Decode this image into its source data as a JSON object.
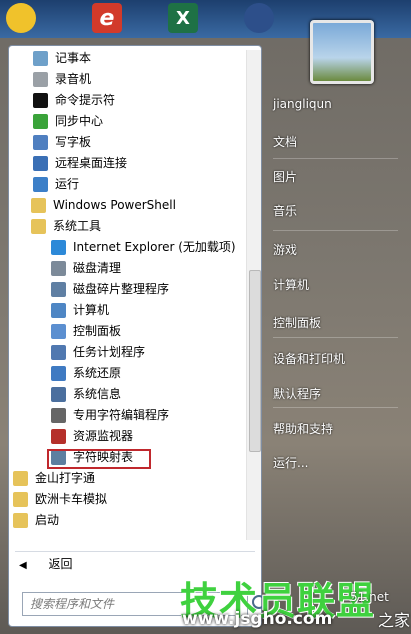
{
  "taskbar_icons": [
    "qq-icon",
    "browser-e-icon",
    "excel-icon",
    "app-icon"
  ],
  "excel_glyph": "X",
  "browser_glyph": "e",
  "programs": [
    {
      "label": "记事本",
      "icon": "notepad-icon",
      "color": "#6ea0c9"
    },
    {
      "label": "录音机",
      "icon": "microphone-icon",
      "color": "#9aa0a6"
    },
    {
      "label": "命令提示符",
      "icon": "cmd-icon",
      "color": "#111111"
    },
    {
      "label": "同步中心",
      "icon": "sync-icon",
      "color": "#3aa33a"
    },
    {
      "label": "写字板",
      "icon": "wordpad-icon",
      "color": "#4f7fc0"
    },
    {
      "label": "远程桌面连接",
      "icon": "remote-desktop-icon",
      "color": "#3a6fb5"
    },
    {
      "label": "运行",
      "icon": "run-icon",
      "color": "#3c7fc8"
    },
    {
      "label": "Windows PowerShell",
      "icon": "folder-icon",
      "color": "#e6c35a"
    },
    {
      "label": "系统工具",
      "icon": "folder-icon",
      "color": "#e6c35a"
    },
    {
      "label": "Internet Explorer (无加载项)",
      "icon": "ie-icon",
      "color": "#2c89d8"
    },
    {
      "label": "磁盘清理",
      "icon": "disk-cleanup-icon",
      "color": "#7c8a99"
    },
    {
      "label": "磁盘碎片整理程序",
      "icon": "defrag-icon",
      "color": "#5f7fa3"
    },
    {
      "label": "计算机",
      "icon": "computer-icon",
      "color": "#4e86c4"
    },
    {
      "label": "控制面板",
      "icon": "control-panel-icon",
      "color": "#5b8fd0"
    },
    {
      "label": "任务计划程序",
      "icon": "clock-icon",
      "color": "#5078b0"
    },
    {
      "label": "系统还原",
      "icon": "restore-icon",
      "color": "#3f7ac2"
    },
    {
      "label": "系统信息",
      "icon": "info-icon",
      "color": "#4b6f9e"
    },
    {
      "label": "专用字符编辑程序",
      "icon": "edit-icon",
      "color": "#666666"
    },
    {
      "label": "资源监视器",
      "icon": "monitor-icon",
      "color": "#b5302b"
    },
    {
      "label": "字符映射表",
      "icon": "charmap-icon",
      "color": "#5d7fa0"
    },
    {
      "label": "金山打字通",
      "icon": "folder-icon",
      "color": "#e6c35a"
    },
    {
      "label": "欧洲卡车模拟",
      "icon": "folder-icon",
      "color": "#e6c35a"
    },
    {
      "label": "启动",
      "icon": "folder-icon",
      "color": "#e6c35a"
    }
  ],
  "back_label": "返回",
  "back_arrow": "◀",
  "search_placeholder": "搜索程序和文件",
  "right_items": [
    "jiangliqun",
    "文档",
    "图片",
    "音乐",
    "游戏",
    "计算机",
    "控制面板",
    "设备和打印机",
    "默认程序",
    "帮助和支持",
    "运行..."
  ],
  "watermark": {
    "brand": "技术员联盟",
    "url": "www.jsgho.com",
    "small": "51.net",
    "suffix": "之家"
  }
}
